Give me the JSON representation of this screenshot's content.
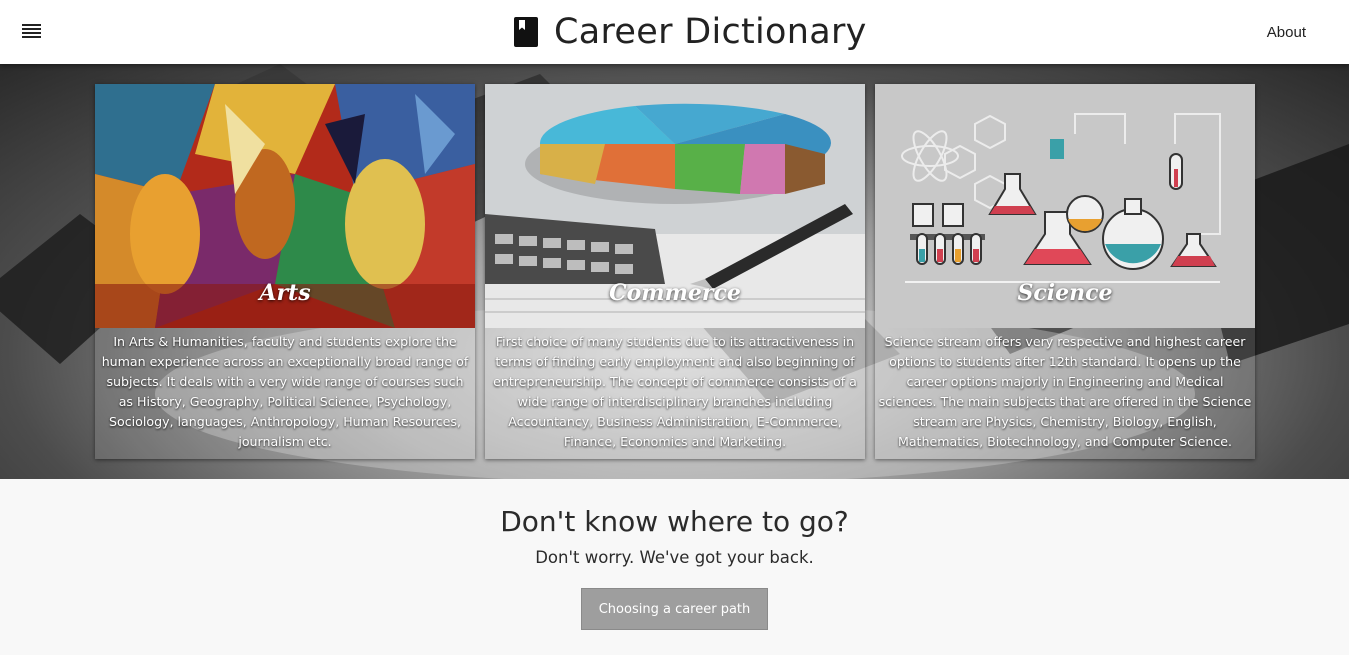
{
  "header": {
    "title": "Career Dictionary",
    "about_label": "About",
    "menu_icon": "hamburger-menu-icon",
    "brand_icon": "bookmark-book-icon"
  },
  "streams": [
    {
      "title": "Arts",
      "description": "In Arts & Humanities, faculty and students explore the human experience across an exceptionally broad range of subjects. It deals with a very wide range of courses such as History, Geography, Political Science, Psychology, Sociology, languages, Anthropology, Human Resources, journalism etc."
    },
    {
      "title": "Commerce",
      "description": "First choice of many students due to its attractiveness in terms of finding early employment and also beginning of entrepreneurship. The concept of commerce consists of a wide range of interdisciplinary branches including Accountancy, Business Administration, E-Commerce, Finance, Economics and Marketing."
    },
    {
      "title": "Science",
      "description": "Science stream offers very respective and highest career options to students after 12th standard. It opens up the career options majorly in Engineering and Medical sciences. The main subjects that are offered in the Science stream are Physics, Chemistry, Biology, English, Mathematics, Biotechnology, and Computer Science."
    }
  ],
  "cta": {
    "title": "Don't know where to go?",
    "subtitle": "Don't worry. We've got your back.",
    "button_label": "Choosing a career path"
  },
  "colors": {
    "header_bg": "#ffffff",
    "cta_button": "#9e9e9e",
    "page_bg": "#f8f8f8"
  }
}
